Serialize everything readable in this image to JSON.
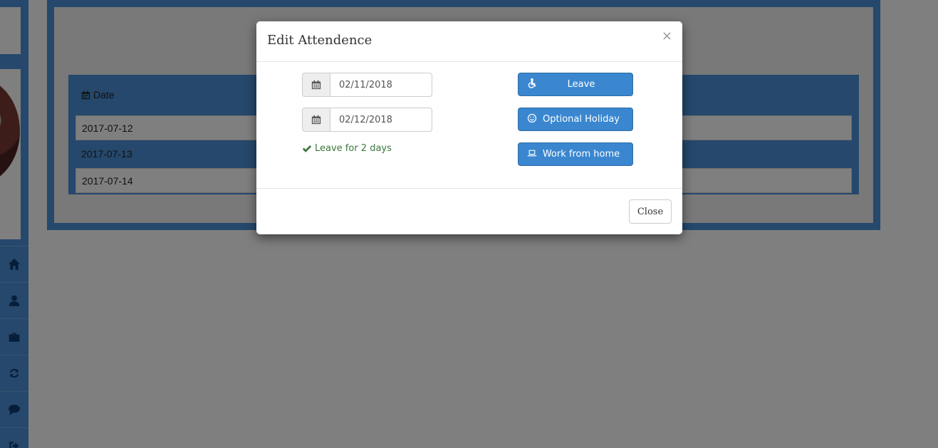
{
  "background": {
    "table": {
      "date_header": "Date",
      "rows": [
        "2017-07-12",
        "2017-07-13",
        "2017-07-14"
      ]
    },
    "sidebar_icons": [
      "home-icon",
      "user-icon",
      "briefcase-icon",
      "refresh-icon",
      "chat-icon",
      "logout-icon"
    ]
  },
  "modal": {
    "title": "Edit Attendence",
    "close_symbol": "×",
    "start_date": "02/11/2018",
    "end_date": "02/12/2018",
    "status_message": "Leave for 2 days",
    "buttons": {
      "leave": "Leave",
      "optional_holiday": "Optional Holiday",
      "work_from_home": "Work from home"
    },
    "footer_close": "Close"
  },
  "colors": {
    "primary": "#3a87d0",
    "success_text": "#3c763d",
    "sidebar": "#4a90d9"
  }
}
